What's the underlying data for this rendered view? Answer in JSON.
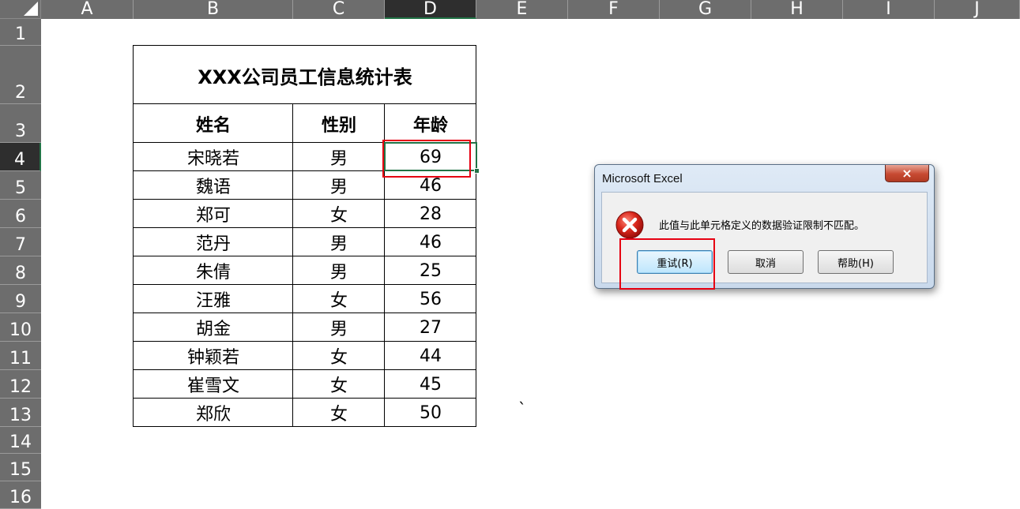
{
  "columns": [
    "A",
    "B",
    "C",
    "D",
    "E",
    "F",
    "G",
    "H",
    "I",
    "J"
  ],
  "rows": [
    "1",
    "2",
    "3",
    "4",
    "5",
    "6",
    "7",
    "8",
    "9",
    "10",
    "11",
    "12",
    "13",
    "14",
    "15",
    "16"
  ],
  "selected_column": "D",
  "selected_row": "4",
  "accent_color": "#217346",
  "highlight_color": "#e60012",
  "table": {
    "title": "XXX公司员工信息统计表",
    "headers": [
      "姓名",
      "性别",
      "年龄"
    ],
    "rows": [
      [
        "宋晓若",
        "男",
        "69"
      ],
      [
        "魏语",
        "男",
        "46"
      ],
      [
        "郑可",
        "女",
        "28"
      ],
      [
        "范丹",
        "男",
        "46"
      ],
      [
        "朱倩",
        "男",
        "25"
      ],
      [
        "汪雅",
        "女",
        "56"
      ],
      [
        "胡金",
        "男",
        "27"
      ],
      [
        "钟颖若",
        "女",
        "44"
      ],
      [
        "崔雪文",
        "女",
        "45"
      ],
      [
        "郑欣",
        "女",
        "50"
      ]
    ]
  },
  "stray_mark": "`",
  "dialog": {
    "title": "Microsoft Excel",
    "close_label": "×",
    "icon": "error-icon",
    "message": "此值与此单元格定义的数据验证限制不匹配。",
    "buttons": {
      "retry": "重试(R)",
      "cancel": "取消",
      "help": "帮助(H)"
    }
  }
}
